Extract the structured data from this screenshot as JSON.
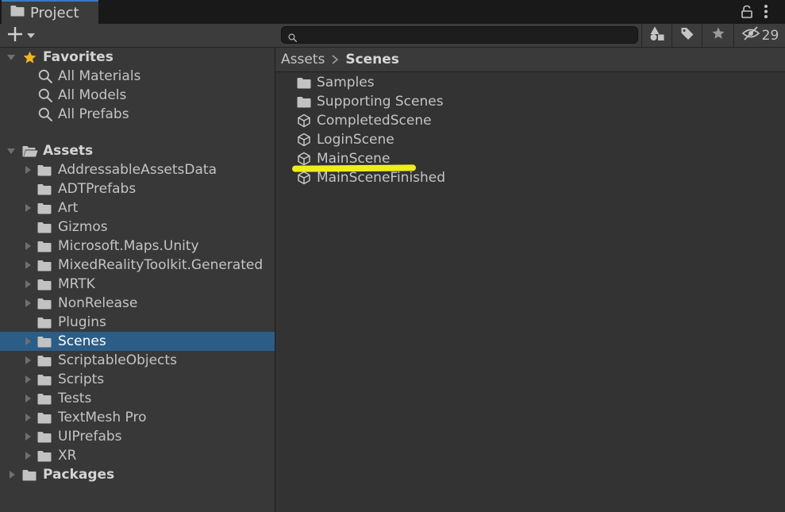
{
  "window": {
    "tab_label": "Project",
    "icons": {
      "tab": "folder-icon",
      "lock": "lock-icon",
      "menu": "kebab-menu-icon"
    }
  },
  "toolbar": {
    "create_icon": "plus-dropdown-icon",
    "search": {
      "value": "",
      "placeholder": "",
      "icon": "search-icon"
    },
    "buttons": [
      "filter-by-type-icon",
      "filter-by-label-icon",
      "favorite-star-icon"
    ],
    "hidden_packages_count": "29"
  },
  "tree": {
    "favorites": {
      "label": "Favorites",
      "items": [
        "All Materials",
        "All Models",
        "All Prefabs"
      ]
    },
    "assets": {
      "label": "Assets",
      "items": [
        {
          "label": "AddressableAssetsData",
          "expandable": true
        },
        {
          "label": "ADTPrefabs",
          "expandable": false
        },
        {
          "label": "Art",
          "expandable": true
        },
        {
          "label": "Gizmos",
          "expandable": false
        },
        {
          "label": "Microsoft.Maps.Unity",
          "expandable": true
        },
        {
          "label": "MixedRealityToolkit.Generated",
          "expandable": true
        },
        {
          "label": "MRTK",
          "expandable": true
        },
        {
          "label": "NonRelease",
          "expandable": true
        },
        {
          "label": "Plugins",
          "expandable": false
        },
        {
          "label": "Scenes",
          "expandable": true,
          "selected": true
        },
        {
          "label": "ScriptableObjects",
          "expandable": true
        },
        {
          "label": "Scripts",
          "expandable": true
        },
        {
          "label": "Tests",
          "expandable": true
        },
        {
          "label": "TextMesh Pro",
          "expandable": true
        },
        {
          "label": "UIPrefabs",
          "expandable": true
        },
        {
          "label": "XR",
          "expandable": true
        }
      ]
    },
    "packages": {
      "label": "Packages"
    }
  },
  "breadcrumb": [
    "Assets",
    "Scenes"
  ],
  "files": [
    {
      "label": "Samples",
      "type": "folder"
    },
    {
      "label": "Supporting Scenes",
      "type": "folder"
    },
    {
      "label": "CompletedScene",
      "type": "scene"
    },
    {
      "label": "LoginScene",
      "type": "scene"
    },
    {
      "label": "MainScene",
      "type": "scene",
      "highlighted": true
    },
    {
      "label": "MainSceneFinished",
      "type": "scene"
    }
  ],
  "colors": {
    "selection": "#2c5d87",
    "highlight": "#f0ee18",
    "favorite_star": "#f0b428"
  }
}
